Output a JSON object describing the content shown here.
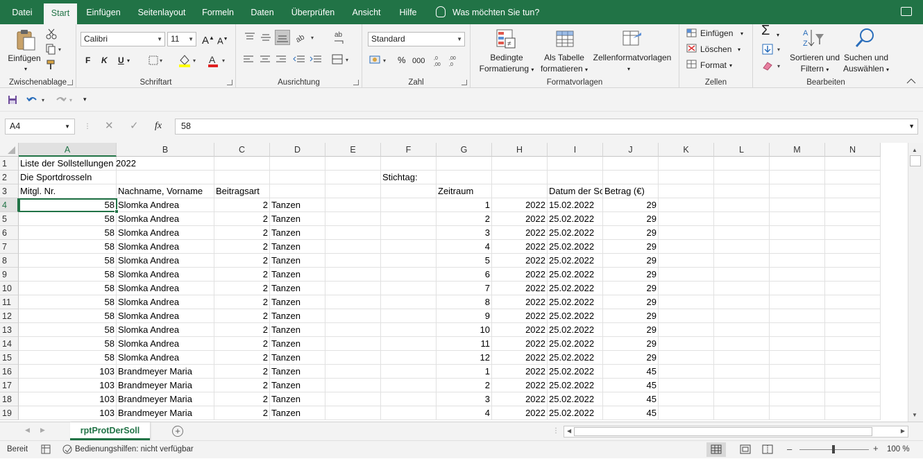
{
  "tabs": [
    "Datei",
    "Start",
    "Einfügen",
    "Seitenlayout",
    "Formeln",
    "Daten",
    "Überprüfen",
    "Ansicht",
    "Hilfe"
  ],
  "tell_me": "Was möchten Sie tun?",
  "ribbon": {
    "clipboard": {
      "paste_label": "Einfügen",
      "group_label": "Zwischenablage"
    },
    "font": {
      "name": "Calibri",
      "size": "11",
      "bold": "F",
      "italic": "K",
      "underline": "U",
      "group_label": "Schriftart"
    },
    "alignment": {
      "group_label": "Ausrichtung"
    },
    "number": {
      "format": "Standard",
      "percent": "%",
      "thousands": "000",
      "group_label": "Zahl"
    },
    "styles": {
      "conditional_line1": "Bedingte",
      "conditional_line2": "Formatierung",
      "table_line1": "Als Tabelle",
      "table_line2": "formatieren",
      "cellstyles": "Zellenformatvorlagen",
      "group_label": "Formatvorlagen"
    },
    "cells": {
      "insert": "Einfügen",
      "delete": "Löschen",
      "format": "Format",
      "group_label": "Zellen"
    },
    "editing": {
      "sort_line1": "Sortieren und",
      "sort_line2": "Filtern",
      "find_line1": "Suchen und",
      "find_line2": "Auswählen",
      "group_label": "Bearbeiten"
    }
  },
  "formula_bar": {
    "name_box": "A4",
    "fx": "fx",
    "value": "58"
  },
  "columns": [
    "A",
    "B",
    "C",
    "D",
    "E",
    "F",
    "G",
    "H",
    "I",
    "J",
    "K",
    "L",
    "M",
    "N"
  ],
  "rows": [
    [
      "1",
      "Liste der Sollstellungen 2022",
      "",
      "",
      "",
      "",
      "",
      "",
      "",
      "",
      ""
    ],
    [
      "2",
      "Die Sportdrosseln",
      "",
      "",
      "",
      "",
      "Stichtag:",
      "",
      "",
      "",
      ""
    ],
    [
      "3",
      "Mitgl. Nr.",
      "Nachname, Vorname",
      "Beitragsart",
      "",
      "",
      "",
      "Zeitraum",
      "",
      "Datum der So",
      "Betrag (€)"
    ],
    [
      "4",
      "58",
      "Slomka Andrea",
      "2",
      "Tanzen",
      "",
      "",
      "1",
      "2022",
      "15.02.2022",
      "29"
    ],
    [
      "5",
      "58",
      "Slomka Andrea",
      "2",
      "Tanzen",
      "",
      "",
      "2",
      "2022",
      "25.02.2022",
      "29"
    ],
    [
      "6",
      "58",
      "Slomka Andrea",
      "2",
      "Tanzen",
      "",
      "",
      "3",
      "2022",
      "25.02.2022",
      "29"
    ],
    [
      "7",
      "58",
      "Slomka Andrea",
      "2",
      "Tanzen",
      "",
      "",
      "4",
      "2022",
      "25.02.2022",
      "29"
    ],
    [
      "8",
      "58",
      "Slomka Andrea",
      "2",
      "Tanzen",
      "",
      "",
      "5",
      "2022",
      "25.02.2022",
      "29"
    ],
    [
      "9",
      "58",
      "Slomka Andrea",
      "2",
      "Tanzen",
      "",
      "",
      "6",
      "2022",
      "25.02.2022",
      "29"
    ],
    [
      "10",
      "58",
      "Slomka Andrea",
      "2",
      "Tanzen",
      "",
      "",
      "7",
      "2022",
      "25.02.2022",
      "29"
    ],
    [
      "11",
      "58",
      "Slomka Andrea",
      "2",
      "Tanzen",
      "",
      "",
      "8",
      "2022",
      "25.02.2022",
      "29"
    ],
    [
      "12",
      "58",
      "Slomka Andrea",
      "2",
      "Tanzen",
      "",
      "",
      "9",
      "2022",
      "25.02.2022",
      "29"
    ],
    [
      "13",
      "58",
      "Slomka Andrea",
      "2",
      "Tanzen",
      "",
      "",
      "10",
      "2022",
      "25.02.2022",
      "29"
    ],
    [
      "14",
      "58",
      "Slomka Andrea",
      "2",
      "Tanzen",
      "",
      "",
      "11",
      "2022",
      "25.02.2022",
      "29"
    ],
    [
      "15",
      "58",
      "Slomka Andrea",
      "2",
      "Tanzen",
      "",
      "",
      "12",
      "2022",
      "25.02.2022",
      "29"
    ],
    [
      "16",
      "103",
      "Brandmeyer Maria",
      "2",
      "Tanzen",
      "",
      "",
      "1",
      "2022",
      "25.02.2022",
      "45"
    ],
    [
      "17",
      "103",
      "Brandmeyer Maria",
      "2",
      "Tanzen",
      "",
      "",
      "2",
      "2022",
      "25.02.2022",
      "45"
    ],
    [
      "18",
      "103",
      "Brandmeyer Maria",
      "2",
      "Tanzen",
      "",
      "",
      "3",
      "2022",
      "25.02.2022",
      "45"
    ],
    [
      "19",
      "103",
      "Brandmeyer Maria",
      "2",
      "Tanzen",
      "",
      "",
      "4",
      "2022",
      "25.02.2022",
      "45"
    ]
  ],
  "sheet_tab": "rptProtDerSoll",
  "status": {
    "mode": "Bereit",
    "accessibility": "Bedienungshilfen: nicht verfügbar",
    "zoom": "100 %"
  },
  "colors": {
    "accent": "#217346",
    "ribbon_bg": "#f3f3f3"
  }
}
